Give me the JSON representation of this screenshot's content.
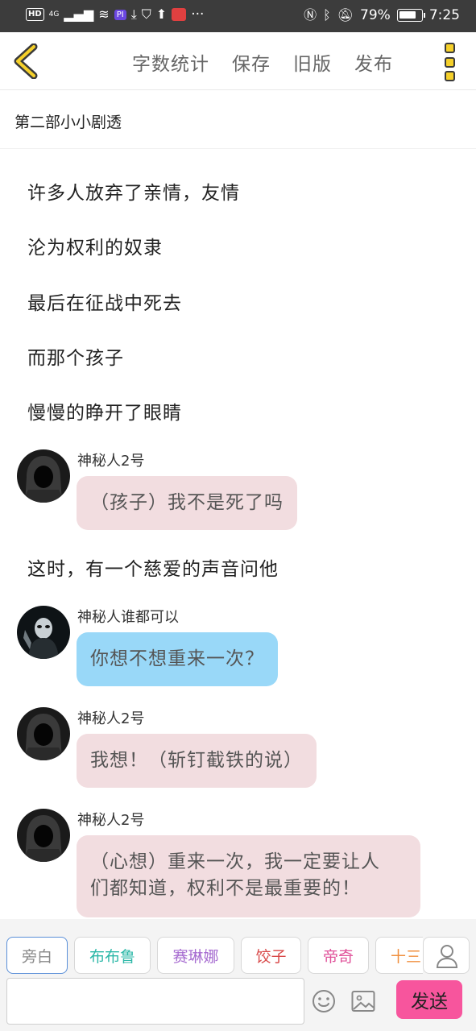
{
  "status_bar": {
    "badge": "HD",
    "network": "4G",
    "app_tag": "PI",
    "battery": "79%",
    "battery_level": 0.79,
    "time": "7:25",
    "more": "···"
  },
  "toolbar": {
    "word_count": "字数统计",
    "save": "保存",
    "old_version": "旧版",
    "publish": "发布"
  },
  "chapter_title": "第二部小小剧透",
  "content": {
    "narration": [
      "许多人放弃了亲情，友情",
      "沦为权利的奴隶",
      "最后在征战中死去",
      "而那个孩子",
      "慢慢的睁开了眼睛",
      "这时，有一个慈爱的声音问他"
    ],
    "messages": [
      {
        "name": "神秘人2号",
        "text": "（孩子）我不是死了吗"
      },
      {
        "name": "神秘人谁都可以",
        "text": "你想不想重来一次？"
      },
      {
        "name": "神秘人2号",
        "text": "我想！（斩钉截铁的说）"
      },
      {
        "name": "神秘人2号",
        "text_line1": "（心想）重来一次，我一定要让人",
        "text_line2": "们都知道，权利不是最重要的！"
      }
    ]
  },
  "characters": [
    {
      "label": "旁白",
      "color": "#8a8a8a"
    },
    {
      "label": "布布鲁",
      "color": "#2db8a8"
    },
    {
      "label": "赛琳娜",
      "color": "#a66bd0"
    },
    {
      "label": "饺子",
      "color": "#d84848"
    },
    {
      "label": "帝奇",
      "color": "#e0529a"
    },
    {
      "label": "十三",
      "color": "#f09040"
    }
  ],
  "input": {
    "placeholder": ""
  },
  "send_label": "发送"
}
